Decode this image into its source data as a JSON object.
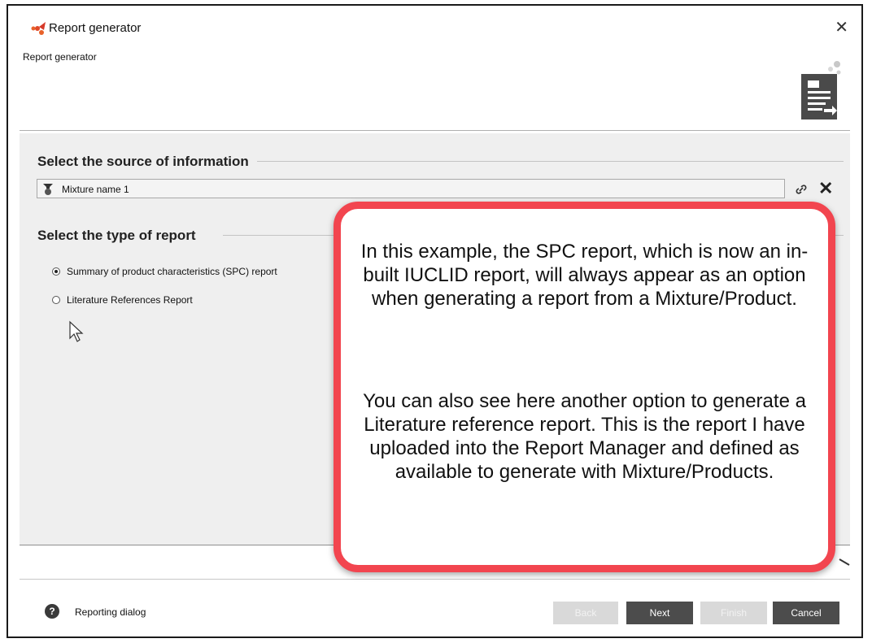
{
  "window": {
    "title": "Report generator",
    "subtitle": "Report generator"
  },
  "sections": {
    "source_title": "Select the source of information",
    "source_value": "Mixture name 1",
    "report_type_title": "Select the type of report"
  },
  "report_options": [
    {
      "label": "Summary of product characteristics (SPC) report",
      "selected": true
    },
    {
      "label": "Literature References Report",
      "selected": false
    }
  ],
  "footer": {
    "help_label": "Reporting dialog",
    "buttons": {
      "back": "Back",
      "next": "Next",
      "finish": "Finish",
      "cancel": "Cancel"
    }
  },
  "callout": {
    "paragraph1": "In this example, the SPC report, which is now an in-built IUCLID report, will always appear as an option when generating a report from a Mixture/Product.",
    "paragraph2": "You can also see here another option to generate a Literature reference report. This is the report I have uploaded into the Report Manager and defined as available to generate with Mixture/Products."
  },
  "colors": {
    "callout_border": "#f2454f",
    "button_active": "#4c4c4c",
    "button_disabled": "#d9d9d9",
    "content_bg": "#efefef"
  },
  "icons": [
    "app-logo-icon",
    "close-icon",
    "report-document-icon",
    "mixture-icon",
    "link-icon",
    "clear-icon",
    "help-icon",
    "mouse-cursor-icon"
  ]
}
